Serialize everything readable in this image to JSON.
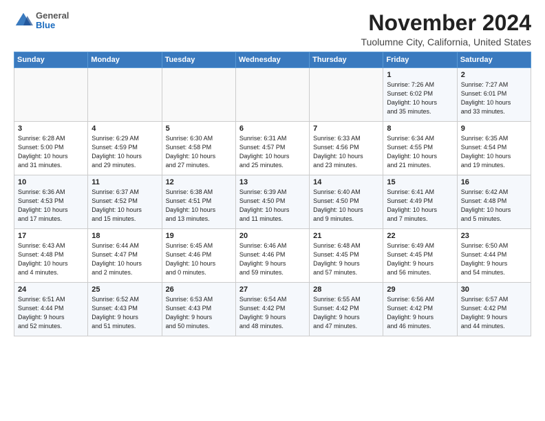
{
  "logo": {
    "general": "General",
    "blue": "Blue"
  },
  "title": "November 2024",
  "location": "Tuolumne City, California, United States",
  "days_header": [
    "Sunday",
    "Monday",
    "Tuesday",
    "Wednesday",
    "Thursday",
    "Friday",
    "Saturday"
  ],
  "weeks": [
    [
      {
        "num": "",
        "info": ""
      },
      {
        "num": "",
        "info": ""
      },
      {
        "num": "",
        "info": ""
      },
      {
        "num": "",
        "info": ""
      },
      {
        "num": "",
        "info": ""
      },
      {
        "num": "1",
        "info": "Sunrise: 7:26 AM\nSunset: 6:02 PM\nDaylight: 10 hours\nand 35 minutes."
      },
      {
        "num": "2",
        "info": "Sunrise: 7:27 AM\nSunset: 6:01 PM\nDaylight: 10 hours\nand 33 minutes."
      }
    ],
    [
      {
        "num": "3",
        "info": "Sunrise: 6:28 AM\nSunset: 5:00 PM\nDaylight: 10 hours\nand 31 minutes."
      },
      {
        "num": "4",
        "info": "Sunrise: 6:29 AM\nSunset: 4:59 PM\nDaylight: 10 hours\nand 29 minutes."
      },
      {
        "num": "5",
        "info": "Sunrise: 6:30 AM\nSunset: 4:58 PM\nDaylight: 10 hours\nand 27 minutes."
      },
      {
        "num": "6",
        "info": "Sunrise: 6:31 AM\nSunset: 4:57 PM\nDaylight: 10 hours\nand 25 minutes."
      },
      {
        "num": "7",
        "info": "Sunrise: 6:33 AM\nSunset: 4:56 PM\nDaylight: 10 hours\nand 23 minutes."
      },
      {
        "num": "8",
        "info": "Sunrise: 6:34 AM\nSunset: 4:55 PM\nDaylight: 10 hours\nand 21 minutes."
      },
      {
        "num": "9",
        "info": "Sunrise: 6:35 AM\nSunset: 4:54 PM\nDaylight: 10 hours\nand 19 minutes."
      }
    ],
    [
      {
        "num": "10",
        "info": "Sunrise: 6:36 AM\nSunset: 4:53 PM\nDaylight: 10 hours\nand 17 minutes."
      },
      {
        "num": "11",
        "info": "Sunrise: 6:37 AM\nSunset: 4:52 PM\nDaylight: 10 hours\nand 15 minutes."
      },
      {
        "num": "12",
        "info": "Sunrise: 6:38 AM\nSunset: 4:51 PM\nDaylight: 10 hours\nand 13 minutes."
      },
      {
        "num": "13",
        "info": "Sunrise: 6:39 AM\nSunset: 4:50 PM\nDaylight: 10 hours\nand 11 minutes."
      },
      {
        "num": "14",
        "info": "Sunrise: 6:40 AM\nSunset: 4:50 PM\nDaylight: 10 hours\nand 9 minutes."
      },
      {
        "num": "15",
        "info": "Sunrise: 6:41 AM\nSunset: 4:49 PM\nDaylight: 10 hours\nand 7 minutes."
      },
      {
        "num": "16",
        "info": "Sunrise: 6:42 AM\nSunset: 4:48 PM\nDaylight: 10 hours\nand 5 minutes."
      }
    ],
    [
      {
        "num": "17",
        "info": "Sunrise: 6:43 AM\nSunset: 4:48 PM\nDaylight: 10 hours\nand 4 minutes."
      },
      {
        "num": "18",
        "info": "Sunrise: 6:44 AM\nSunset: 4:47 PM\nDaylight: 10 hours\nand 2 minutes."
      },
      {
        "num": "19",
        "info": "Sunrise: 6:45 AM\nSunset: 4:46 PM\nDaylight: 10 hours\nand 0 minutes."
      },
      {
        "num": "20",
        "info": "Sunrise: 6:46 AM\nSunset: 4:46 PM\nDaylight: 9 hours\nand 59 minutes."
      },
      {
        "num": "21",
        "info": "Sunrise: 6:48 AM\nSunset: 4:45 PM\nDaylight: 9 hours\nand 57 minutes."
      },
      {
        "num": "22",
        "info": "Sunrise: 6:49 AM\nSunset: 4:45 PM\nDaylight: 9 hours\nand 56 minutes."
      },
      {
        "num": "23",
        "info": "Sunrise: 6:50 AM\nSunset: 4:44 PM\nDaylight: 9 hours\nand 54 minutes."
      }
    ],
    [
      {
        "num": "24",
        "info": "Sunrise: 6:51 AM\nSunset: 4:44 PM\nDaylight: 9 hours\nand 52 minutes."
      },
      {
        "num": "25",
        "info": "Sunrise: 6:52 AM\nSunset: 4:43 PM\nDaylight: 9 hours\nand 51 minutes."
      },
      {
        "num": "26",
        "info": "Sunrise: 6:53 AM\nSunset: 4:43 PM\nDaylight: 9 hours\nand 50 minutes."
      },
      {
        "num": "27",
        "info": "Sunrise: 6:54 AM\nSunset: 4:42 PM\nDaylight: 9 hours\nand 48 minutes."
      },
      {
        "num": "28",
        "info": "Sunrise: 6:55 AM\nSunset: 4:42 PM\nDaylight: 9 hours\nand 47 minutes."
      },
      {
        "num": "29",
        "info": "Sunrise: 6:56 AM\nSunset: 4:42 PM\nDaylight: 9 hours\nand 46 minutes."
      },
      {
        "num": "30",
        "info": "Sunrise: 6:57 AM\nSunset: 4:42 PM\nDaylight: 9 hours\nand 44 minutes."
      }
    ]
  ]
}
